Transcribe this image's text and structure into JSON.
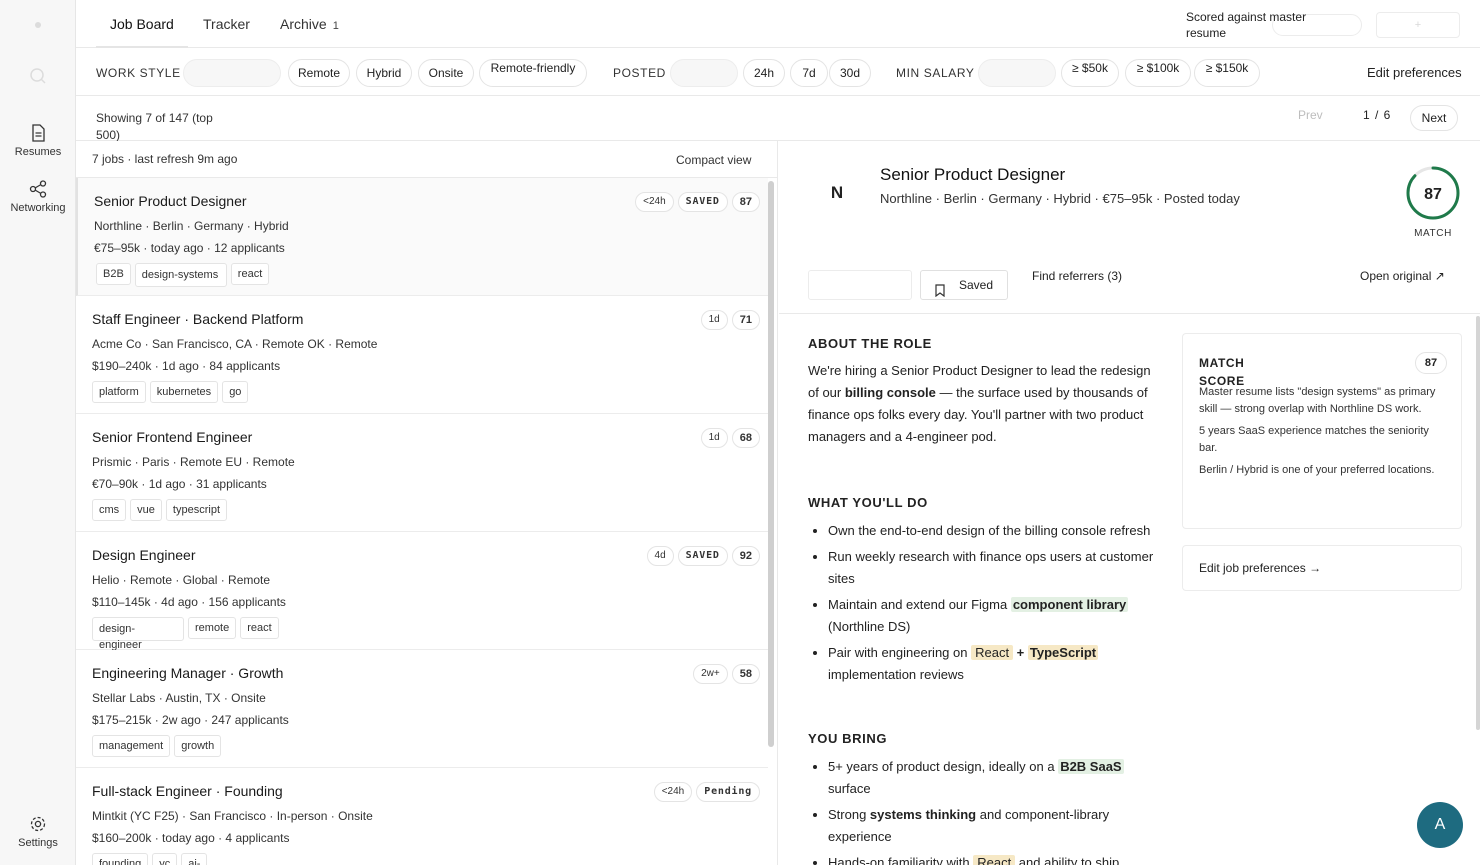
{
  "rail": {
    "items": [
      {
        "label": "Resumes",
        "icon": "file-icon"
      },
      {
        "label": "Networking",
        "icon": "share-icon"
      },
      {
        "label": "Settings",
        "icon": "gear-icon"
      }
    ]
  },
  "tabs": [
    {
      "label": "Job Board",
      "active": true
    },
    {
      "label": "Tracker"
    },
    {
      "label": "Archive",
      "count": "1"
    }
  ],
  "header": {
    "scored_label": "Scored against master resume"
  },
  "filters": {
    "work_style_label": "WORK STYLE",
    "work_style_options": [
      "Remote",
      "Hybrid",
      "Onsite",
      "Remote-friendly"
    ],
    "posted_label": "POSTED",
    "posted_options": [
      "24h",
      "7d",
      "30d"
    ],
    "min_salary_label": "MIN SALARY",
    "salary_options": [
      "≥ $50k",
      "≥ $100k",
      "≥ $150k"
    ],
    "edit_prefs": "Edit preferences"
  },
  "pagination": {
    "showing": "Showing 7 of 147 (top 500)",
    "prev": "Prev",
    "page": "1 / 6",
    "next": "Next"
  },
  "list": {
    "meta": "7 jobs · last refresh 9m ago",
    "compact": "Compact view",
    "jobs": [
      {
        "title": "Senior Product Designer",
        "location": "Northline · Berlin · Germany · Hybrid",
        "salary": "€75–95k · today ago · 12 applicants",
        "tags": [
          "B2B",
          "design-systems",
          "react"
        ],
        "age": "<24h",
        "status": "SAVED",
        "score": "87"
      },
      {
        "title": "Staff Engineer · Backend Platform",
        "location": "Acme Co · San Francisco, CA · Remote OK · Remote",
        "salary": "$190–240k · 1d ago · 84 applicants",
        "tags": [
          "platform",
          "kubernetes",
          "go"
        ],
        "age": "1d",
        "score": "71"
      },
      {
        "title": "Senior Frontend Engineer",
        "location": "Prismic · Paris · Remote EU · Remote",
        "salary": "€70–90k · 1d ago · 31 applicants",
        "tags": [
          "cms",
          "vue",
          "typescript"
        ],
        "age": "1d",
        "score": "68"
      },
      {
        "title": "Design Engineer",
        "location": "Helio · Remote · Global · Remote",
        "salary": "$110–145k · 4d ago · 156 applicants",
        "tags": [
          "design-engineer",
          "remote",
          "react"
        ],
        "age": "4d",
        "status": "SAVED",
        "score": "92"
      },
      {
        "title": "Engineering Manager · Growth",
        "location": "Stellar Labs · Austin, TX · Onsite",
        "salary": "$175–215k · 2w ago · 247 applicants",
        "tags": [
          "management",
          "growth"
        ],
        "age": "2w+",
        "score": "58"
      },
      {
        "title": "Full-stack Engineer · Founding",
        "location": "Mintkit (YC F25) · San Francisco · In-person · Onsite",
        "salary": "$160–200k · today ago · 4 applicants",
        "tags": [
          "founding",
          "yc",
          "ai-"
        ],
        "age": "<24h",
        "status": "Pending"
      }
    ]
  },
  "detail": {
    "logo_letter": "N",
    "title": "Senior Product Designer",
    "subtitle": "Northline · Berlin · Germany · Hybrid · €75–95k · Posted today",
    "match_score": 87,
    "match_label": "MATCH",
    "saved": "Saved",
    "find_referrers": "Find referrers (3)",
    "open_original": "Open original ↗",
    "about_heading": "ABOUT THE ROLE",
    "about": {
      "p1": "We're hiring a Senior Product Designer to lead the redesign of our ",
      "b1": "billing console",
      "p2": " — the surface used by thousands of finance ops folks every day. You'll partner with two product managers and a 4-engineer pod."
    },
    "do_heading": "WHAT YOU'LL DO",
    "do_items": {
      "d1": "Own the end-to-end design of the billing console refresh",
      "d2": "Run weekly research with finance ops users at customer sites",
      "d3a": "Maintain and extend our Figma ",
      "d3b": "component library",
      "d3c": " (Northline DS)",
      "d4a": "Pair with engineering on ",
      "d4b": "React",
      "d4c": " + ",
      "d4d": "TypeScript",
      "d4e": " implementation reviews"
    },
    "bring_heading": "YOU BRING",
    "bring_items": {
      "b1a": "5+ years of product design, ideally on a ",
      "b1b": "B2B SaaS",
      "b1c": " surface",
      "b2a": "Strong ",
      "b2b": "systems thinking",
      "b2c": " and component-library experience",
      "b3a": "Hands-on familiarity with ",
      "b3b": "React",
      "b3c": " and ability to ship"
    },
    "match_card": {
      "title": "MATCH SCORE",
      "score": "87",
      "reasons": [
        "Master resume lists \"design systems\" as primary skill — strong overlap with Northline DS work.",
        "5 years SaaS experience matches the seniority bar.",
        "Berlin / Hybrid is one of your preferred locations."
      ]
    },
    "edit_job_prefs": "Edit job preferences →"
  },
  "user": {
    "avatar": "A"
  },
  "colors": {
    "accent": "#1e6b80",
    "match_ring": "#1f7a4a"
  }
}
